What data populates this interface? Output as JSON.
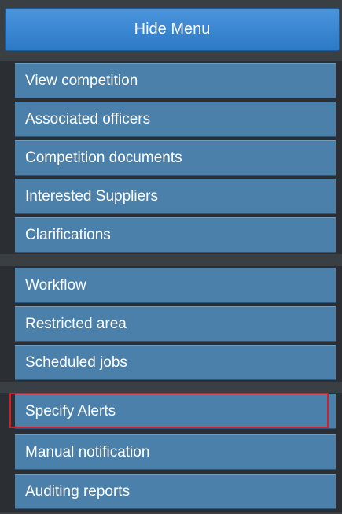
{
  "header": {
    "hide_menu_label": "Hide Menu"
  },
  "menu": {
    "groups": [
      {
        "items": [
          {
            "label": "View competition"
          },
          {
            "label": "Associated officers"
          },
          {
            "label": "Competition documents"
          },
          {
            "label": "Interested Suppliers"
          },
          {
            "label": "Clarifications"
          }
        ]
      },
      {
        "items": [
          {
            "label": "Workflow"
          },
          {
            "label": "Restricted area"
          },
          {
            "label": "Scheduled jobs"
          }
        ]
      },
      {
        "items": [
          {
            "label": "Specify Alerts",
            "highlighted": true
          },
          {
            "label": "Manual notification"
          },
          {
            "label": "Auditing reports"
          }
        ]
      }
    ]
  },
  "colors": {
    "button_blue": "#3a86d1",
    "item_blue": "#4b80aa",
    "highlight_red": "#d41f2a"
  }
}
